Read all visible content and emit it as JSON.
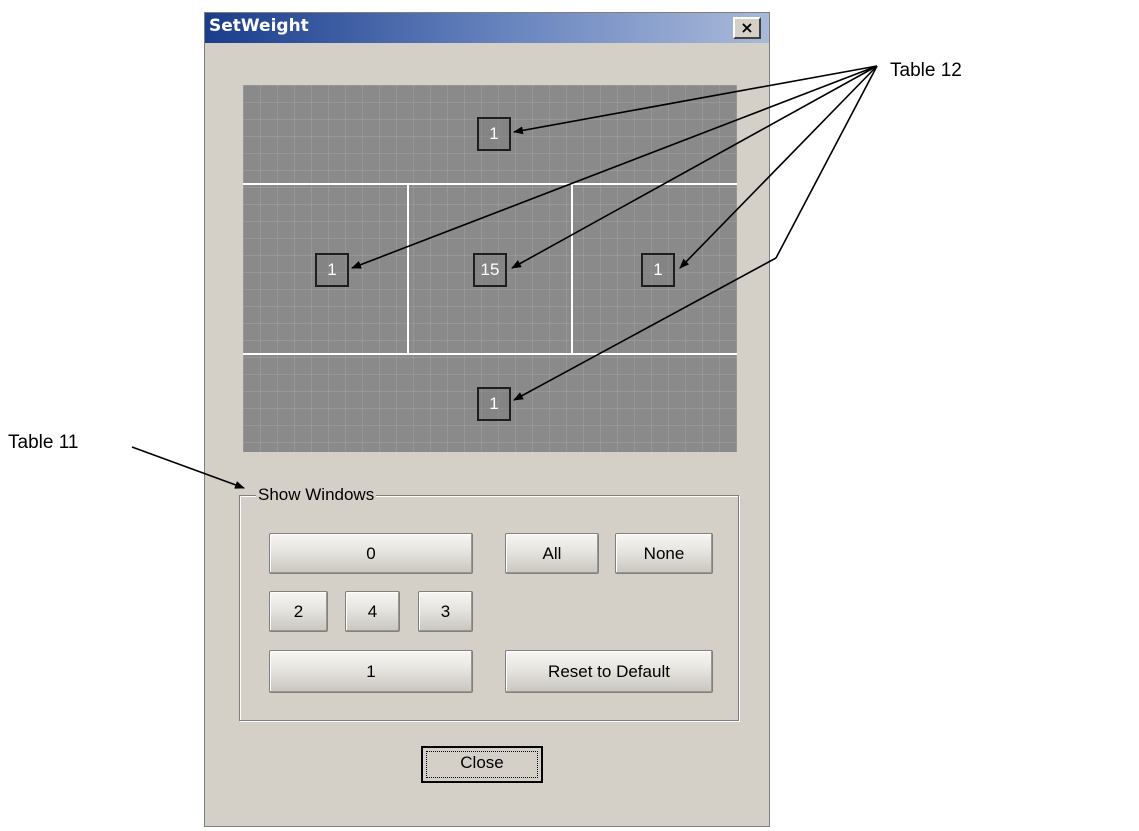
{
  "dialog": {
    "title": "SetWeight",
    "close_glyph": "×",
    "close_icon": "close-icon"
  },
  "weights": {
    "top": "1",
    "left": "1",
    "center": "15",
    "right": "1",
    "bottom": "1"
  },
  "show_windows": {
    "legend": "Show Windows",
    "buttons": {
      "w0": "0",
      "w2": "2",
      "w4": "4",
      "w3": "3",
      "w1": "1",
      "all": "All",
      "none": "None",
      "reset": "Reset to Default"
    }
  },
  "footer": {
    "close_label": "Close"
  },
  "callouts": {
    "table12": "Table 12",
    "table11": "Table 11"
  }
}
